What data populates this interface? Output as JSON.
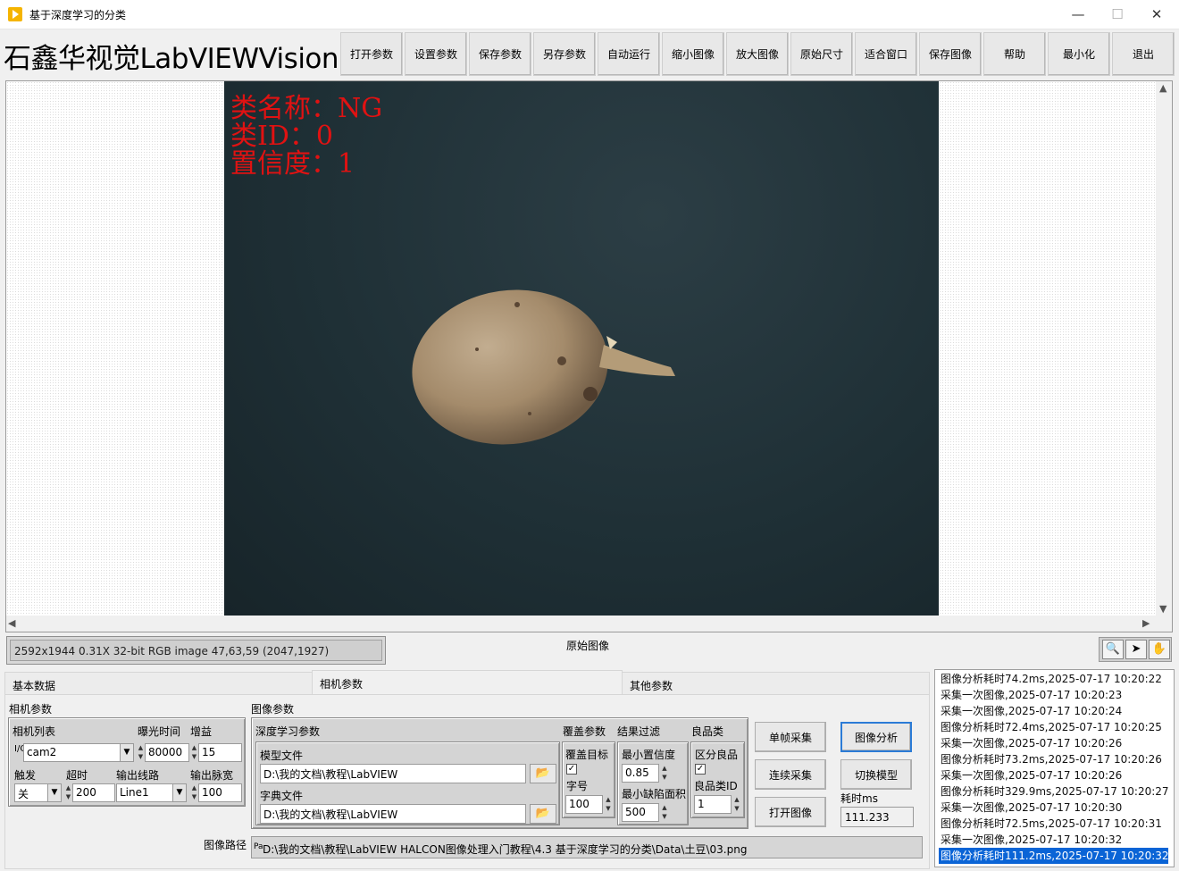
{
  "window": {
    "title": "基于深度学习的分类",
    "minimize": "—",
    "maximize": "☐",
    "close": "✕"
  },
  "header": {
    "brand": "石鑫华视觉LabVIEWVision",
    "toolbar": [
      "打开参数",
      "设置参数",
      "保存参数",
      "另存参数",
      "自动运行",
      "缩小图像",
      "放大图像",
      "原始尺寸",
      "适合窗口",
      "保存图像",
      "帮助",
      "最小化",
      "退出"
    ]
  },
  "display": {
    "overlay": {
      "class_name": "类名称：NG",
      "class_id": "类ID：0",
      "confidence": "置信度：1"
    },
    "status": "2592x1944 0.31X 32-bit RGB image 47,63,59    (2047,1927)",
    "caption": "原始图像"
  },
  "tabs": {
    "basic": "基本数据",
    "camera": "相机参数",
    "other": "其他参数",
    "active": "camera"
  },
  "camera_params": {
    "title": "相机参数",
    "camera_list_label": "相机列表",
    "camera_list_value": "cam2",
    "exposure_label": "曝光时间",
    "exposure_value": "80000",
    "gain_label": "增益",
    "gain_value": "15",
    "trigger_label": "触发",
    "trigger_value": "关",
    "timeout_label": "超时",
    "timeout_value": "200",
    "output_line_label": "输出线路",
    "output_line_value": "Line1",
    "pulse_label": "输出脉宽",
    "pulse_value": "100"
  },
  "image_params": {
    "title": "图像参数",
    "dl_title": "深度学习参数",
    "model_label": "模型文件",
    "model_value": "D:\\我的文档\\教程\\LabVIEW",
    "dict_label": "字典文件",
    "dict_value": "D:\\我的文档\\教程\\LabVIEW",
    "overlay_title": "覆盖参数",
    "overlay_target_label": "覆盖目标",
    "overlay_target_checked": true,
    "font_size_label": "字号",
    "font_size_value": "100",
    "filter_title": "结果过滤",
    "min_conf_label": "最小置信度",
    "min_conf_value": "0.85",
    "min_defect_label": "最小缺陷面积",
    "min_defect_value": "500",
    "good_title": "良品类",
    "distinguish_label": "区分良品",
    "distinguish_checked": true,
    "good_id_label": "良品类ID",
    "good_id_value": "1"
  },
  "actions": {
    "single_capture": "单帧采集",
    "continuous_capture": "连续采集",
    "open_image": "打开图像",
    "analyze": "图像分析",
    "switch_model": "切换模型",
    "time_label": "耗时ms",
    "time_value": "111.233"
  },
  "image_path": {
    "label": "图像路径",
    "value": "D:\\我的文档\\教程\\LabVIEW HALCON图像处理入门教程\\4.3 基于深度学习的分类\\Data\\土豆\\03.png"
  },
  "log": [
    "图像分析耗时74.2ms,2025-07-17 10:20:22",
    "采集一次图像,2025-07-17 10:20:23",
    "采集一次图像,2025-07-17 10:20:24",
    "图像分析耗时72.4ms,2025-07-17 10:20:25",
    "采集一次图像,2025-07-17 10:20:26",
    "图像分析耗时73.2ms,2025-07-17 10:20:26",
    "采集一次图像,2025-07-17 10:20:26",
    "图像分析耗时329.9ms,2025-07-17 10:20:27",
    "采集一次图像,2025-07-17 10:20:30",
    "图像分析耗时72.5ms,2025-07-17 10:20:31",
    "采集一次图像,2025-07-17 10:20:32",
    "图像分析耗时111.2ms,2025-07-17 10:20:32"
  ],
  "log_selected_index": 11,
  "colors": {
    "overlay_text": "#e01212",
    "selection": "#0a64d6",
    "image_background": "#1f3036"
  }
}
